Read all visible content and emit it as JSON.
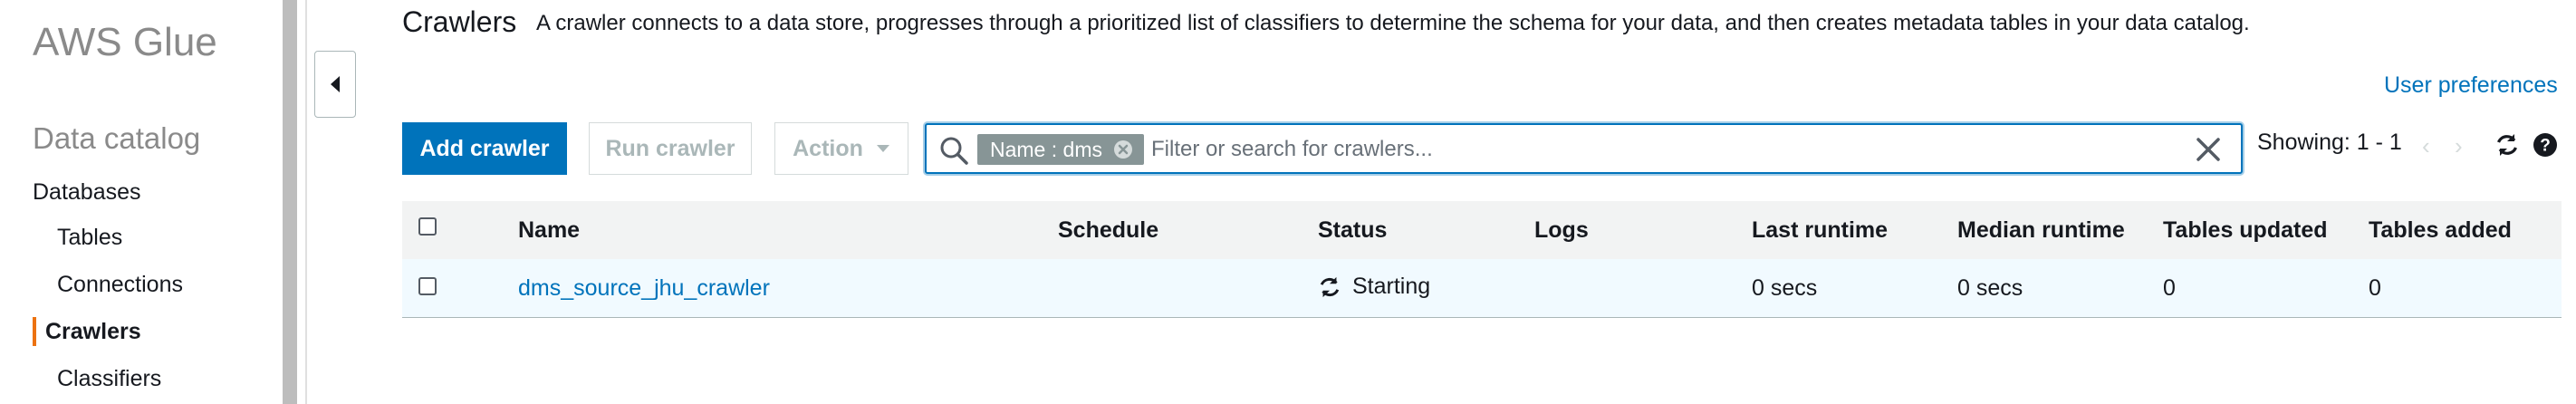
{
  "sidebar": {
    "app_title": "AWS Glue",
    "section_title": "Data catalog",
    "items": [
      {
        "label": "Databases"
      },
      {
        "label": "Tables"
      },
      {
        "label": "Connections"
      },
      {
        "label": "Crawlers",
        "active": true
      },
      {
        "label": "Classifiers"
      }
    ]
  },
  "header": {
    "title": "Crawlers",
    "description": "A crawler connects to a data store, progresses through a prioritized list of classifiers to determine the schema for your data, and then creates metadata tables in your data catalog.",
    "user_preferences": "User preferences"
  },
  "toolbar": {
    "add_label": "Add crawler",
    "run_label": "Run crawler",
    "action_label": "Action",
    "search": {
      "chip_label": "Name : dms",
      "placeholder": "Filter or search for crawlers...",
      "value": ""
    },
    "showing": "Showing: 1 - 1"
  },
  "table": {
    "columns": [
      "Name",
      "Schedule",
      "Status",
      "Logs",
      "Last runtime",
      "Median runtime",
      "Tables updated",
      "Tables added"
    ],
    "rows": [
      {
        "name": "dms_source_jhu_crawler",
        "schedule": "",
        "status": "Starting",
        "logs": "",
        "last_runtime": "0 secs",
        "median_runtime": "0 secs",
        "tables_updated": "0",
        "tables_added": "0"
      }
    ]
  },
  "icons": {
    "search": "search-icon",
    "clear": "close-icon",
    "refresh": "refresh-icon",
    "help": "help-icon",
    "status": "refresh-icon",
    "collapse": "caret-left-icon"
  },
  "colors": {
    "accent": "#0073bb",
    "active_indicator": "#ec7211",
    "chip": "#879596",
    "selected_row": "#f1faff"
  }
}
